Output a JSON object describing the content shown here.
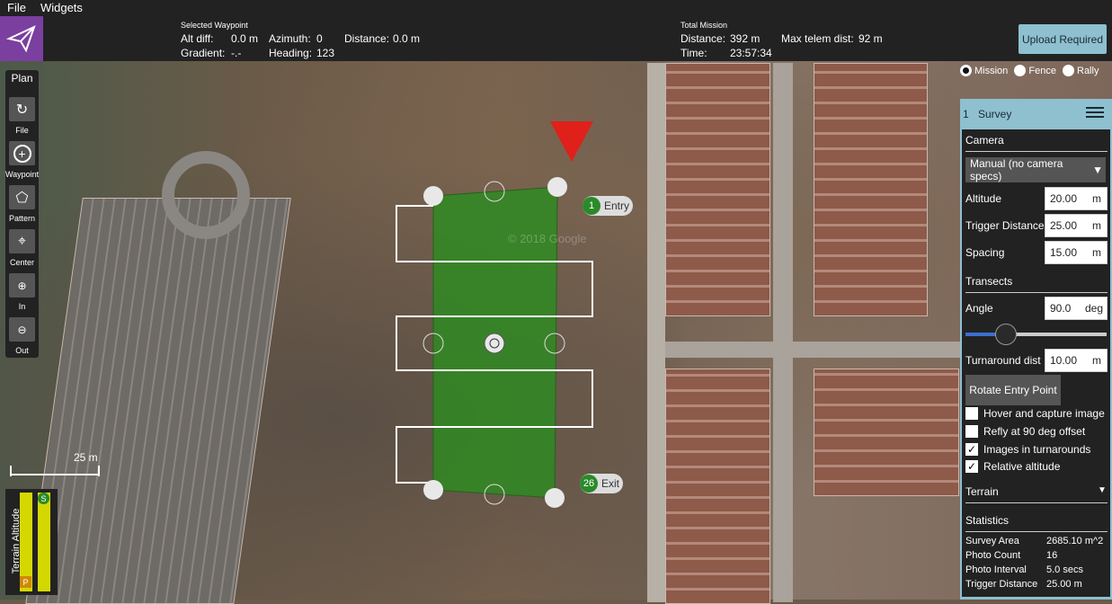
{
  "menu": {
    "file": "File",
    "widgets": "Widgets"
  },
  "toolbar": {
    "selected_waypoint_title": "Selected Waypoint",
    "alt_diff_label": "Alt diff:",
    "alt_diff_value": "0.0 m",
    "azimuth_label": "Azimuth:",
    "azimuth_value": "0",
    "distance_label": "Distance:",
    "distance_value": "0.0 m",
    "gradient_label": "Gradient:",
    "gradient_value": "-.-",
    "heading_label": "Heading:",
    "heading_value": "123",
    "total_mission_title": "Total Mission",
    "total_distance_label": "Distance:",
    "total_distance_value": "392 m",
    "max_telem_label": "Max telem dist:",
    "max_telem_value": "92 m",
    "time_label": "Time:",
    "time_value": "23:57:34",
    "upload_button": "Upload Required"
  },
  "plan_tools": {
    "title": "Plan",
    "items": [
      {
        "label": "File",
        "icon": "file-icon"
      },
      {
        "label": "Waypoint",
        "icon": "plus-icon"
      },
      {
        "label": "Pattern",
        "icon": "pattern-icon"
      },
      {
        "label": "Center",
        "icon": "center-icon"
      },
      {
        "label": "In",
        "icon": "zoom-in-icon"
      },
      {
        "label": "Out",
        "icon": "zoom-out-icon"
      }
    ]
  },
  "layer_radios": {
    "mission": "Mission",
    "fence": "Fence",
    "rally": "Rally",
    "selected": "Mission"
  },
  "survey": {
    "index": "1",
    "title": "Survey",
    "camera_section": "Camera",
    "camera_select": "Manual (no camera specs)",
    "altitude_label": "Altitude",
    "altitude_value": "20.00",
    "altitude_unit": "m",
    "trigger_label": "Trigger Distance",
    "trigger_value": "25.00",
    "trigger_unit": "m",
    "spacing_label": "Spacing",
    "spacing_value": "15.00",
    "spacing_unit": "m",
    "transects_section": "Transects",
    "angle_label": "Angle",
    "angle_value": "90.0",
    "angle_unit": "deg",
    "angle_slider_fraction": 0.25,
    "turnaround_label": "Turnaround dist",
    "turnaround_value": "10.00",
    "turnaround_unit": "m",
    "rotate_button": "Rotate Entry Point",
    "checkboxes": [
      {
        "label": "Hover and capture image",
        "checked": false
      },
      {
        "label": "Refly at 90 deg offset",
        "checked": false
      },
      {
        "label": "Images in turnarounds",
        "checked": true
      },
      {
        "label": "Relative altitude",
        "checked": true
      }
    ],
    "terrain_section": "Terrain",
    "statistics_section": "Statistics",
    "stats": [
      {
        "label": "Survey Area",
        "value": "2685.10 m^2"
      },
      {
        "label": "Photo Count",
        "value": "16"
      },
      {
        "label": "Photo Interval",
        "value": "5.0 secs"
      },
      {
        "label": "Trigger Distance",
        "value": "25.00 m"
      }
    ]
  },
  "map": {
    "entry_label": "Entry",
    "entry_num": "1",
    "exit_label": "Exit",
    "exit_num": "26",
    "scale_label": "25 m",
    "watermark": "© 2018 Google"
  },
  "terrain_widget": {
    "label": "Terrain Altitude",
    "s": "S",
    "p": "P"
  },
  "colors": {
    "accent": "#7b3fa0",
    "panel": "#8ec0d0",
    "survey_fill": "#2f8a22",
    "vehicle": "#e0201a"
  }
}
